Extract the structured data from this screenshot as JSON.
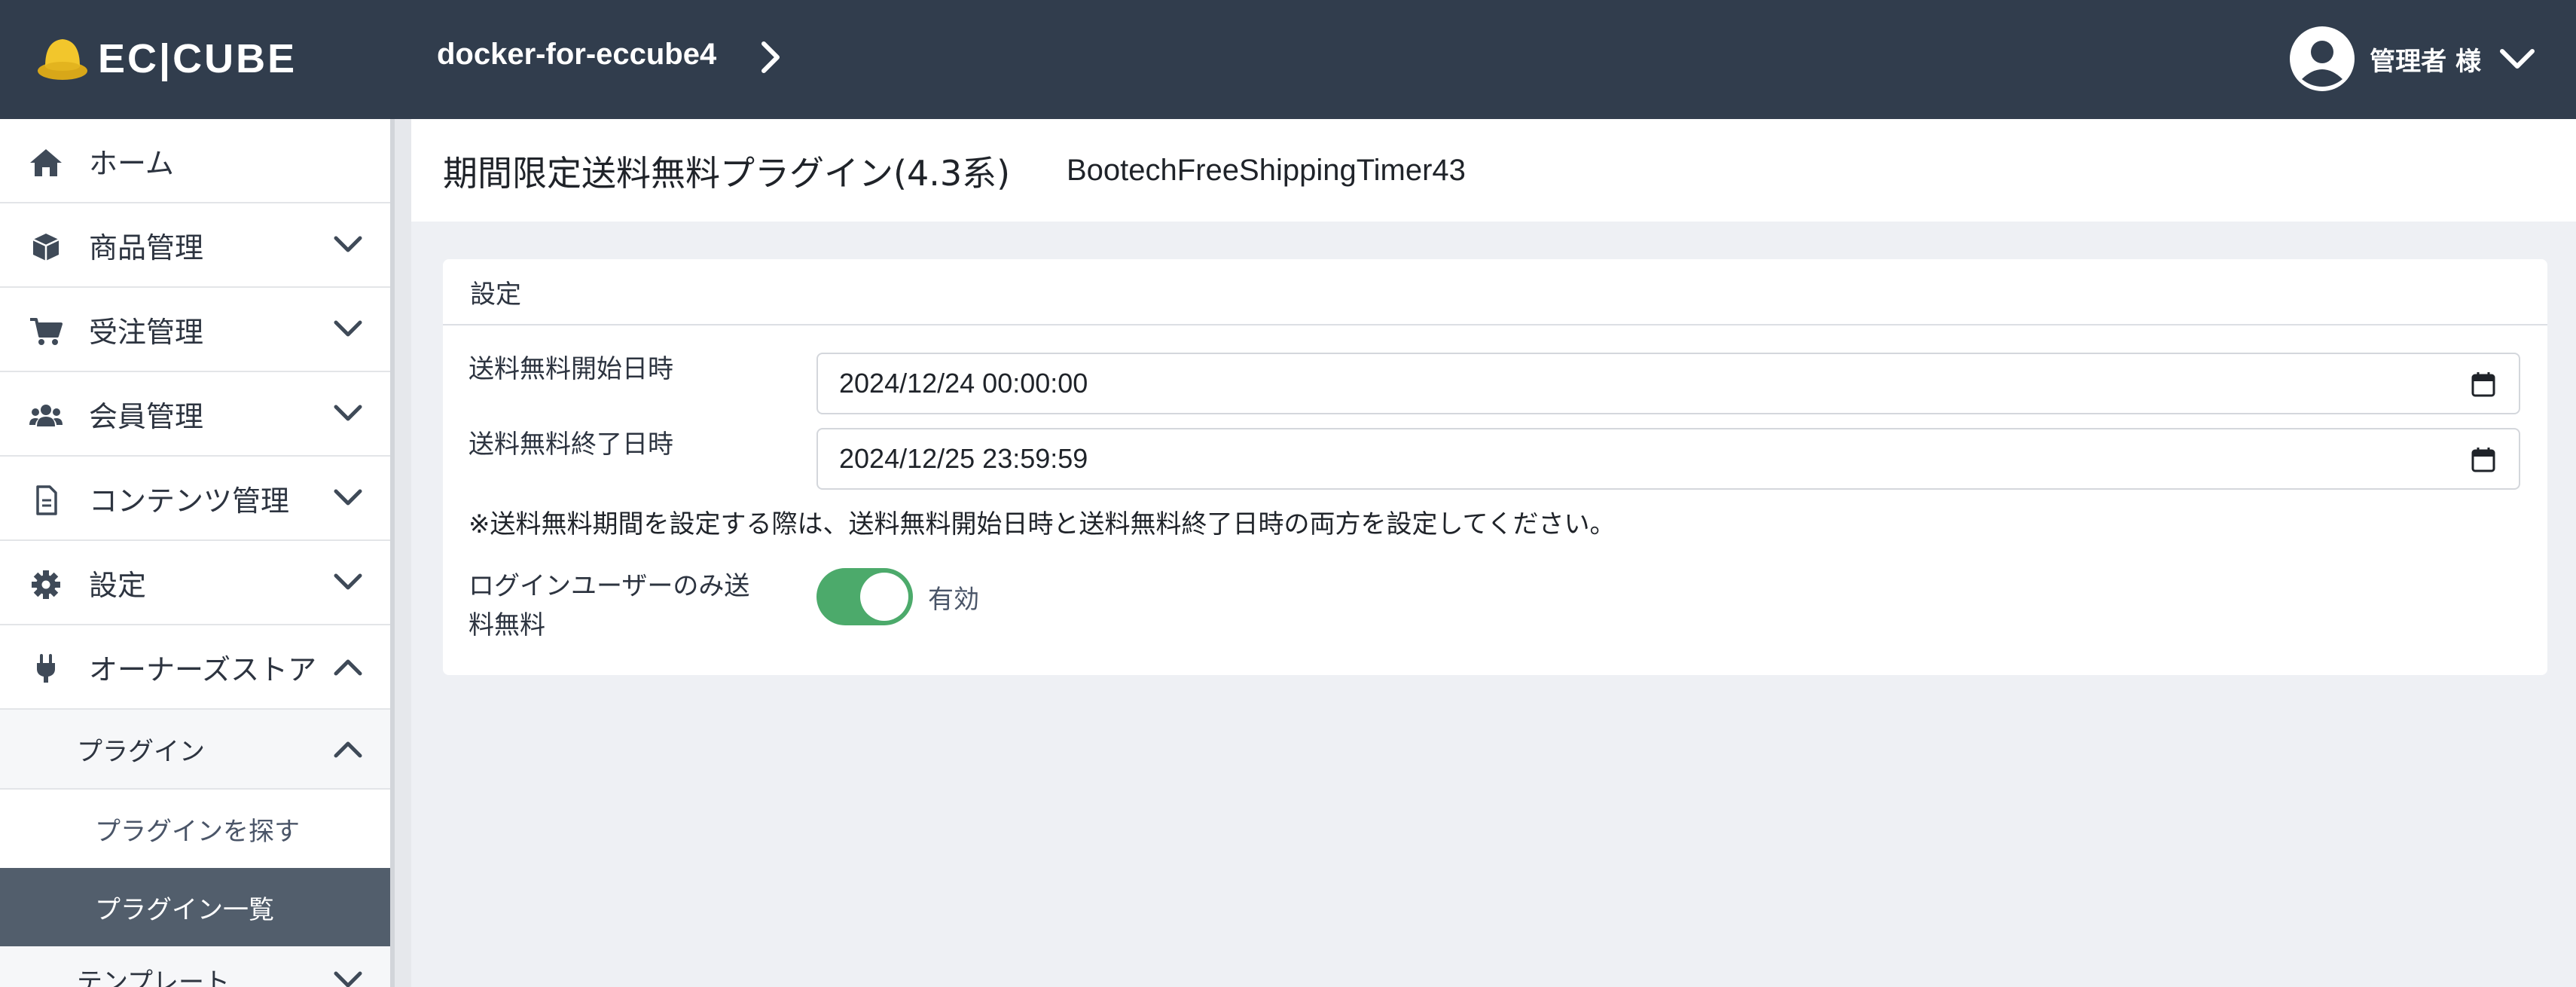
{
  "header": {
    "logo_text": "EC|CUBE",
    "shop_name": "docker-for-eccube4",
    "admin_name": "管理者 様"
  },
  "sidebar": {
    "items": [
      {
        "label": "ホーム",
        "icon": "home-icon"
      },
      {
        "label": "商品管理",
        "icon": "box-icon"
      },
      {
        "label": "受注管理",
        "icon": "cart-icon"
      },
      {
        "label": "会員管理",
        "icon": "users-icon"
      },
      {
        "label": "コンテンツ管理",
        "icon": "file-icon"
      },
      {
        "label": "設定",
        "icon": "gear-icon"
      },
      {
        "label": "オーナーズストア",
        "icon": "plug-icon"
      }
    ],
    "sub": {
      "plugin": "プラグイン",
      "find_plugin": "プラグインを探す",
      "plugin_list": "プラグイン一覧",
      "template": "テンプレート"
    }
  },
  "page": {
    "title": "期間限定送料無料プラグイン(4.3系)",
    "subtitle": "BootechFreeShippingTimer43"
  },
  "settings": {
    "card_title": "設定",
    "start_label": "送料無料開始日時",
    "start_value": "2024/12/24 00:00:00",
    "end_label": "送料無料終了日時",
    "end_value": "2024/12/25 23:59:59",
    "note": "※送料無料期間を設定する際は、送料無料開始日時と送料無料終了日時の両方を設定してください。",
    "login_only_label_1": "ログインユーザーのみ送",
    "login_only_label_2": "料無料",
    "toggle_label": "有効",
    "toggle_on": true
  },
  "colors": {
    "header_bg": "#313d4d",
    "active_nav_bg": "#525e6c",
    "toggle_on": "#4caa6b"
  }
}
